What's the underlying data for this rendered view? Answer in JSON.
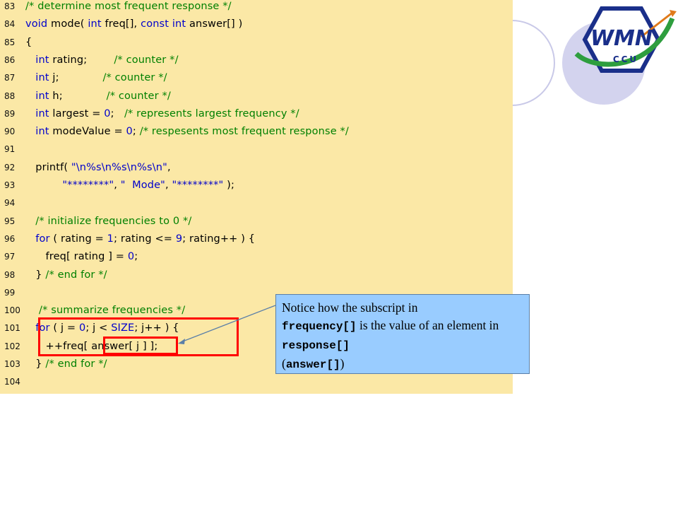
{
  "code_lines": [
    {
      "n": "83",
      "segs": [
        [
          "cm",
          "/* determine most frequent response */"
        ]
      ]
    },
    {
      "n": "84",
      "segs": [
        [
          "kw",
          "void"
        ],
        [
          "",
          " mode( "
        ],
        [
          "kw",
          "int"
        ],
        [
          "",
          " freq[], "
        ],
        [
          "kw",
          "const int"
        ],
        [
          "",
          " answer[] )"
        ]
      ]
    },
    {
      "n": "85",
      "segs": [
        [
          "",
          "{"
        ]
      ]
    },
    {
      "n": "86",
      "segs": [
        [
          "",
          "   "
        ],
        [
          "kw",
          "int"
        ],
        [
          "",
          " rating;        "
        ],
        [
          "cm",
          "/* counter */"
        ]
      ]
    },
    {
      "n": "87",
      "segs": [
        [
          "",
          "   "
        ],
        [
          "kw",
          "int"
        ],
        [
          "",
          " j;             "
        ],
        [
          "cm",
          "/* counter */"
        ]
      ]
    },
    {
      "n": "88",
      "segs": [
        [
          "",
          "   "
        ],
        [
          "kw",
          "int"
        ],
        [
          "",
          " h;             "
        ],
        [
          "cm",
          "/* counter */"
        ]
      ]
    },
    {
      "n": "89",
      "segs": [
        [
          "",
          "   "
        ],
        [
          "kw",
          "int"
        ],
        [
          "",
          " largest = "
        ],
        [
          "num",
          "0"
        ],
        [
          "",
          ";   "
        ],
        [
          "cm",
          "/* represents largest frequency */"
        ]
      ]
    },
    {
      "n": "90",
      "segs": [
        [
          "",
          "   "
        ],
        [
          "kw",
          "int"
        ],
        [
          "",
          " modeValue = "
        ],
        [
          "num",
          "0"
        ],
        [
          "",
          "; "
        ],
        [
          "cm",
          "/* respesents most frequent response */"
        ]
      ]
    },
    {
      "n": "91",
      "segs": [
        [
          "",
          ""
        ]
      ]
    },
    {
      "n": "92",
      "segs": [
        [
          "",
          "   printf( "
        ],
        [
          "str",
          "\"\\n%s\\n%s\\n%s\\n\""
        ],
        [
          "",
          ","
        ]
      ]
    },
    {
      "n": "93",
      "segs": [
        [
          "",
          "           "
        ],
        [
          "str",
          "\"********\""
        ],
        [
          "",
          ", "
        ],
        [
          "str",
          "\"  Mode\""
        ],
        [
          "",
          ", "
        ],
        [
          "str",
          "\"********\""
        ],
        [
          "",
          " );"
        ]
      ]
    },
    {
      "n": "94",
      "segs": [
        [
          "",
          ""
        ]
      ]
    },
    {
      "n": "95",
      "segs": [
        [
          "",
          "   "
        ],
        [
          "cm",
          "/* initialize frequencies to 0 */"
        ]
      ]
    },
    {
      "n": "96",
      "segs": [
        [
          "",
          "   "
        ],
        [
          "kw",
          "for"
        ],
        [
          "",
          " ( rating = "
        ],
        [
          "num",
          "1"
        ],
        [
          "",
          "; rating <= "
        ],
        [
          "num",
          "9"
        ],
        [
          "",
          "; rating++ ) {"
        ]
      ]
    },
    {
      "n": "97",
      "segs": [
        [
          "",
          "      freq[ rating ] = "
        ],
        [
          "num",
          "0"
        ],
        [
          "",
          ";"
        ]
      ]
    },
    {
      "n": "98",
      "segs": [
        [
          "",
          "   } "
        ],
        [
          "cm",
          "/* end for */"
        ]
      ]
    },
    {
      "n": "99",
      "segs": [
        [
          "",
          ""
        ]
      ]
    },
    {
      "n": "100",
      "segs": [
        [
          "",
          "    "
        ],
        [
          "cm",
          "/* summarize frequencies */"
        ]
      ]
    },
    {
      "n": "101",
      "segs": [
        [
          "",
          "   "
        ],
        [
          "kw",
          "for"
        ],
        [
          "",
          " ( j = "
        ],
        [
          "num",
          "0"
        ],
        [
          "",
          "; j < "
        ],
        [
          "mac",
          "SIZE"
        ],
        [
          "",
          "; j++ ) {"
        ]
      ]
    },
    {
      "n": "102",
      "segs": [
        [
          "",
          "      ++freq[ answer[ j ] ];"
        ]
      ]
    },
    {
      "n": "103",
      "segs": [
        [
          "",
          "   } "
        ],
        [
          "cm",
          "/* end for */"
        ]
      ]
    },
    {
      "n": "104",
      "segs": [
        [
          "",
          ""
        ]
      ]
    }
  ],
  "callout": {
    "text1": "Notice how the subscript in",
    "mono1": "frequency[]",
    "text2": " is the value of an element in ",
    "mono2": "response[]",
    "text3": "(",
    "mono3": "answer[]",
    "text4": ")"
  },
  "logo": {
    "text": "WMN",
    "subtext": "CCU",
    "colors": {
      "primary": "#1a2f8a",
      "green": "#2e9e3e",
      "orange": "#e07a1a"
    }
  },
  "colors": {
    "code_bg": "#fbe8a6",
    "keyword": "#0000cc",
    "comment": "#008000",
    "highlight": "#ff0000",
    "callout_bg": "#99ccff"
  }
}
